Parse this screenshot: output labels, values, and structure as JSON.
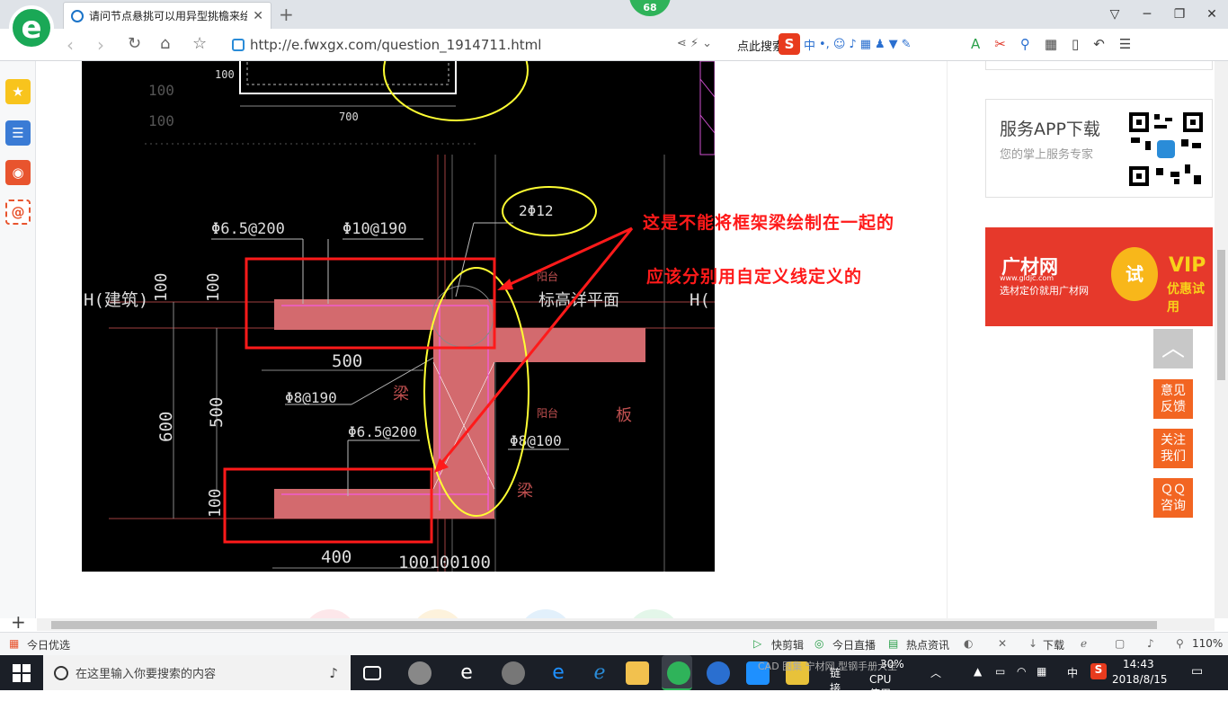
{
  "browser": {
    "tab_title": "请问节点悬挑可以用异型挑檐来绘制吗",
    "notification_count": "68",
    "url": "http://e.fwxgx.com/question_1914711.html",
    "search_label": "点此搜索",
    "ime_text": "中",
    "window_controls": [
      "▽",
      "─",
      "❐",
      "✕"
    ]
  },
  "cad": {
    "top_dims": {
      "d100": "100",
      "d700": "700"
    },
    "labels": {
      "rebar_top_left": "Φ6.5@200",
      "rebar_top_mid": "Φ10@190",
      "rebar_circle": "2Φ12",
      "rebar_mid": "Φ8@190",
      "rebar_low": "Φ6.5@200",
      "rebar_right": "Φ8@100",
      "building": "H(建筑)",
      "h_right": "H(",
      "elevation": "标高详平面",
      "dim_500_top": "500",
      "dim_400": "400",
      "dim_600": "600",
      "dim_500_left": "500",
      "dim_100_a": "100",
      "dim_100_b": "100",
      "dim_100_c": "100",
      "dim_bottom": "100100100",
      "beam1": "梁",
      "beam2": "梁",
      "board": "板",
      "yangtai1": "阳台",
      "yangtai2": "阳台"
    },
    "annotation_line1": "这是不能将框架梁绘制在一起的",
    "annotation_line2": "应该分别用自定义线定义的"
  },
  "sidebar_right": {
    "app_title": "服务APP下载",
    "app_sub": "您的掌上服务专家",
    "ad_brand": "广材网",
    "ad_site": "www.gldjc.com",
    "ad_slogan": "选材定价就用广材网",
    "ad_try": "试",
    "ad_vip": "VIP",
    "ad_vip_sub": "优惠试用",
    "float_buttons": [
      "意见\n反馈",
      "关注\n我们",
      "ＱＱ\n咨询"
    ]
  },
  "statusbar": {
    "left": "今日优选",
    "items": [
      "快剪辑",
      "今日直播",
      "热点资讯",
      "下载"
    ],
    "zoom": "110%"
  },
  "taskbar": {
    "search_placeholder": "在这里输入你要搜索的内容",
    "cpu_percent": "30%",
    "cpu_label": "CPU使用",
    "link_label": "链接",
    "overflow_text": "CAD 图集  宁材网  型钢手册大全",
    "ime": "中",
    "time": "14:43",
    "date": "2018/8/15"
  },
  "colors": {
    "accent_green": "#2fb35a",
    "annotation_red": "#ff1a1a",
    "beam_fill": "#d36a6e",
    "highlight_yellow": "#ffff33",
    "orange_btn": "#f26522",
    "ad_red": "#e6392b"
  }
}
